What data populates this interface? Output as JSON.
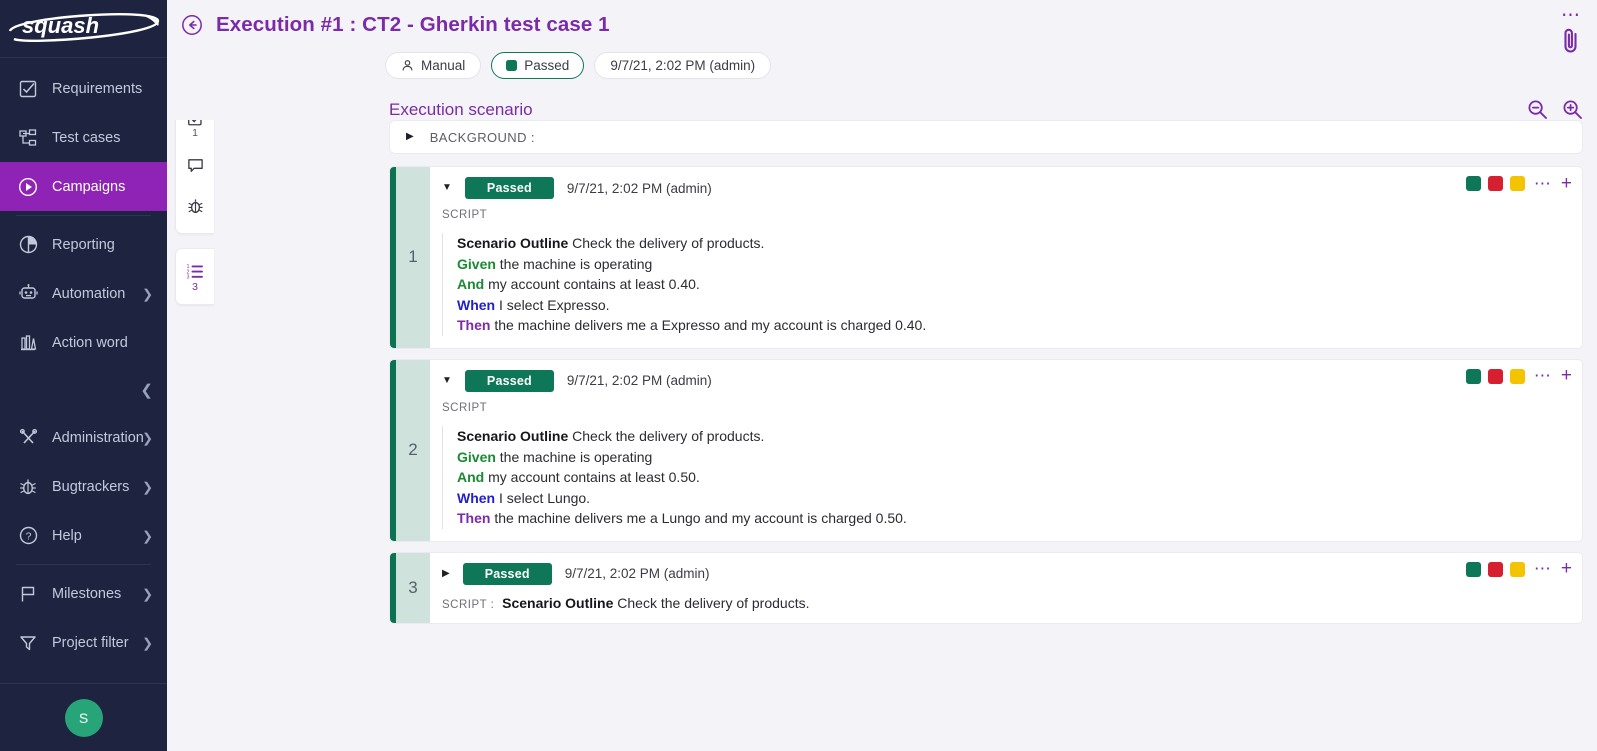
{
  "brand": {
    "logo_text": "squash",
    "accent": "#8f23b5",
    "sidebar_bg": "#1e2440"
  },
  "sidebar": {
    "items": [
      {
        "label": "Requirements",
        "icon": "checkbox-square-icon",
        "active": false,
        "expandable": false
      },
      {
        "label": "Test cases",
        "icon": "tree-hierarchy-icon",
        "active": false,
        "expandable": false
      },
      {
        "label": "Campaigns",
        "icon": "play-circle-icon",
        "active": true,
        "expandable": false
      },
      {
        "label": "Reporting",
        "icon": "pie-chart-icon",
        "active": false,
        "expandable": false
      },
      {
        "label": "Automation",
        "icon": "robot-icon",
        "active": false,
        "expandable": true
      },
      {
        "label": "Action word",
        "icon": "book-icon",
        "active": false,
        "expandable": false
      },
      {
        "label": "Administration",
        "icon": "tools-cross-icon",
        "active": false,
        "expandable": true
      },
      {
        "label": "Bugtrackers",
        "icon": "bug-icon",
        "active": false,
        "expandable": true
      },
      {
        "label": "Help",
        "icon": "question-circle-icon",
        "active": false,
        "expandable": true
      },
      {
        "label": "Milestones",
        "icon": "flag-icon",
        "active": false,
        "expandable": true
      },
      {
        "label": "Project filter",
        "icon": "funnel-filter-icon",
        "active": false,
        "expandable": true
      }
    ],
    "collapse_icon": "chevron-left-icon",
    "avatar_initial": "S",
    "avatar_color": "#27a579"
  },
  "header": {
    "back_icon": "arrow-left-circle-icon",
    "title": "Execution #1 : CT2 - Gherkin test case 1",
    "overflow_icon": "ellipsis-icon",
    "attachment_icon": "paperclip-icon",
    "chips": [
      {
        "label": "Manual",
        "icon": "person-icon",
        "type": "mode"
      },
      {
        "label": "Passed",
        "icon": "status-square",
        "type": "status",
        "color": "#0e7757"
      },
      {
        "label": "9/7/21, 2:02 PM (admin)",
        "icon": "",
        "type": "date"
      }
    ]
  },
  "rail": {
    "cards": [
      {
        "buttons": [
          {
            "icon": "info-icon",
            "count": "",
            "active": false
          },
          {
            "icon": "checkbox-task-icon",
            "count": "1",
            "active": false
          },
          {
            "icon": "comment-bubble-icon",
            "count": "",
            "active": false
          },
          {
            "icon": "bug-icon",
            "count": "",
            "active": false
          }
        ]
      },
      {
        "buttons": [
          {
            "icon": "ordered-list-icon",
            "count": "3",
            "active": true
          }
        ]
      }
    ]
  },
  "section": {
    "title": "Execution scenario",
    "zoom_out_icon": "zoom-out-icon",
    "zoom_in_icon": "zoom-in-icon"
  },
  "background_row": {
    "caret_icon": "caret-right-icon",
    "label": "BACKGROUND :"
  },
  "row_actions": {
    "status_squares": [
      {
        "name": "pass-square",
        "color": "#0e7757"
      },
      {
        "name": "fail-square",
        "color": "#d61f31"
      },
      {
        "name": "blocked-square",
        "color": "#f5c400"
      }
    ],
    "menu_icon": "ellipsis-icon",
    "add_icon": "plus-icon"
  },
  "scenarios": [
    {
      "number": "1",
      "expanded": true,
      "caret_icon": "caret-down-icon",
      "status": "Passed",
      "status_color": "#0e7757",
      "date": "9/7/21, 2:02 PM (admin)",
      "script_label": "SCRIPT",
      "lines": [
        {
          "keyword": "Scenario Outline",
          "kw_class": "kw-outline",
          "text": " Check the delivery of products."
        },
        {
          "keyword": "Given",
          "kw_class": "kw-given",
          "text": " the machine is operating"
        },
        {
          "keyword": "And",
          "kw_class": "kw-and",
          "text": " my account contains at least 0.40."
        },
        {
          "keyword": "",
          "kw_class": "",
          "text": ""
        },
        {
          "keyword": "When",
          "kw_class": "kw-when",
          "text": " I select Expresso."
        },
        {
          "keyword": "",
          "kw_class": "",
          "text": ""
        },
        {
          "keyword": "Then",
          "kw_class": "kw-then",
          "text": " the machine delivers me a Expresso and my account is charged 0.40."
        }
      ]
    },
    {
      "number": "2",
      "expanded": true,
      "caret_icon": "caret-down-icon",
      "status": "Passed",
      "status_color": "#0e7757",
      "date": "9/7/21, 2:02 PM (admin)",
      "script_label": "SCRIPT",
      "lines": [
        {
          "keyword": "Scenario Outline",
          "kw_class": "kw-outline",
          "text": " Check the delivery of products."
        },
        {
          "keyword": "Given",
          "kw_class": "kw-given",
          "text": " the machine is operating"
        },
        {
          "keyword": "And",
          "kw_class": "kw-and",
          "text": " my account contains at least 0.50."
        },
        {
          "keyword": "",
          "kw_class": "",
          "text": ""
        },
        {
          "keyword": "When",
          "kw_class": "kw-when",
          "text": " I select Lungo."
        },
        {
          "keyword": "",
          "kw_class": "",
          "text": ""
        },
        {
          "keyword": "Then",
          "kw_class": "kw-then",
          "text": " the machine delivers me a Lungo and my account is charged 0.50."
        }
      ]
    },
    {
      "number": "3",
      "expanded": false,
      "caret_icon": "caret-right-icon",
      "status": "Passed",
      "status_color": "#0e7757",
      "date": "9/7/21, 2:02 PM (admin)",
      "script_label": "SCRIPT :",
      "summary_keyword": "Scenario Outline",
      "summary_text": " Check the delivery of products.",
      "lines": []
    }
  ]
}
